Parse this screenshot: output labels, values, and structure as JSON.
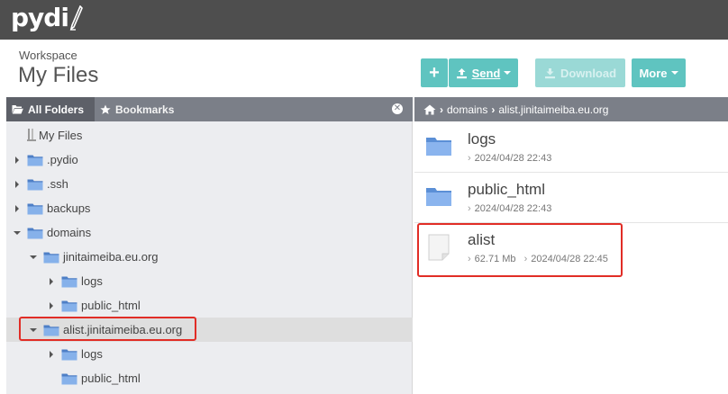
{
  "brand": {
    "logo_text": "pydi"
  },
  "workspace": {
    "label": "Workspace",
    "title": "My Files"
  },
  "toolbar": {
    "add_label": "+",
    "send_label": "Send",
    "download_label": "Download",
    "more_label": "More"
  },
  "left_tabs": {
    "folders": "All Folders",
    "bookmarks": "Bookmarks"
  },
  "tree": [
    {
      "label": "My Files",
      "depth": 0,
      "toggle": "none",
      "icon": "server-icon"
    },
    {
      "label": ".pydio",
      "depth": 0,
      "toggle": "collapsed",
      "icon": "folder-icon"
    },
    {
      "label": ".ssh",
      "depth": 0,
      "toggle": "collapsed",
      "icon": "folder-icon"
    },
    {
      "label": "backups",
      "depth": 0,
      "toggle": "collapsed",
      "icon": "folder-icon"
    },
    {
      "label": "domains",
      "depth": 0,
      "toggle": "expanded",
      "icon": "folder-icon"
    },
    {
      "label": "jinitaimeiba.eu.org",
      "depth": 1,
      "toggle": "expanded",
      "icon": "folder-icon"
    },
    {
      "label": "logs",
      "depth": 2,
      "toggle": "collapsed",
      "icon": "folder-icon"
    },
    {
      "label": "public_html",
      "depth": 2,
      "toggle": "collapsed",
      "icon": "folder-icon"
    },
    {
      "label": "alist.jinitaimeiba.eu.org",
      "depth": 1,
      "toggle": "expanded",
      "icon": "folder-icon",
      "selected": true
    },
    {
      "label": "logs",
      "depth": 2,
      "toggle": "collapsed",
      "icon": "folder-icon"
    },
    {
      "label": "public_html",
      "depth": 2,
      "toggle": "none",
      "icon": "folder-icon"
    }
  ],
  "breadcrumb": {
    "items": [
      "domains",
      "alist.jinitaimeiba.eu.org"
    ]
  },
  "files": [
    {
      "name": "logs",
      "type": "folder",
      "size": "",
      "date": "2024/04/28 22:43"
    },
    {
      "name": "public_html",
      "type": "folder",
      "size": "",
      "date": "2024/04/28 22:43"
    },
    {
      "name": "alist",
      "type": "file",
      "size": "62.71 Mb",
      "date": "2024/04/28 22:45"
    }
  ],
  "colors": {
    "accent": "#5fc4c0",
    "topbar": "#4e4e4e",
    "panel_header": "#7b7f88",
    "highlight": "#e12d26",
    "folder": "#6a9ee8"
  }
}
